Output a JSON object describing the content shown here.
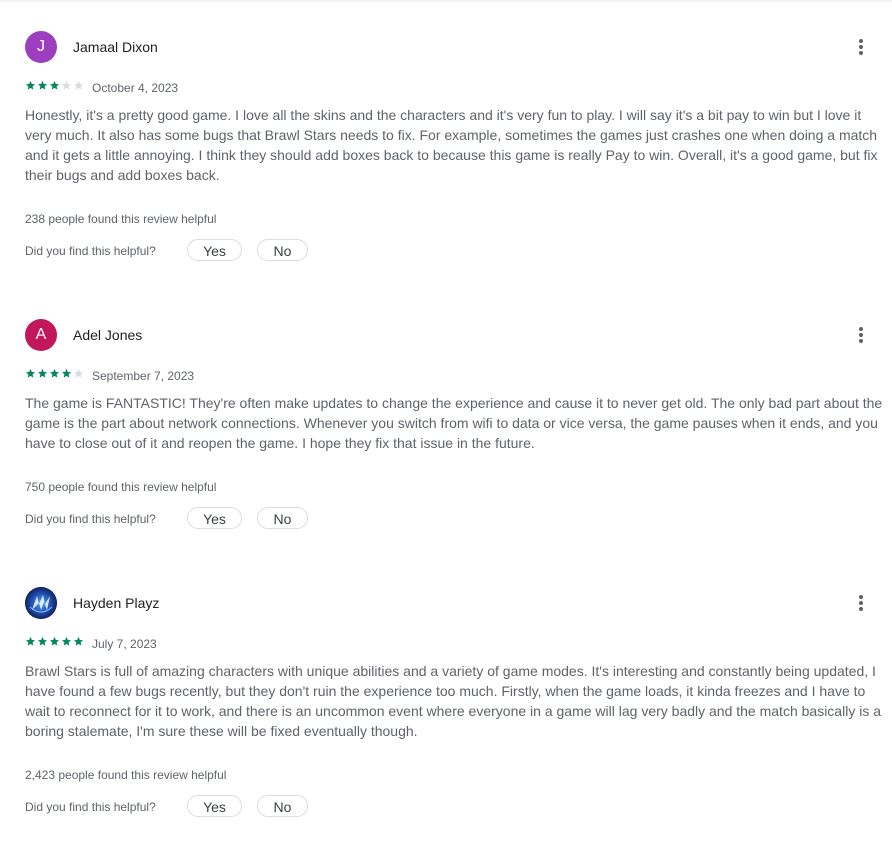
{
  "colors": {
    "star_filled": "#01875f",
    "star_empty": "#dadce0",
    "text_secondary": "#5f6368"
  },
  "reviews": [
    {
      "author": "Jamaal Dixon",
      "avatar_letter": "J",
      "avatar_color": "#9c3fbf",
      "rating": 3,
      "date": "October 4, 2023",
      "text": "Honestly, it's a pretty good game. I love all the skins and the characters and it's very fun to play. I will say it's a bit pay to win but I love it very much. It also has some bugs that Brawl Stars needs to fix. For example, sometimes the games just crashes one when doing a match and it gets a little annoying. I think they should add boxes back to because this game is really Pay to win. Overall, it's a good game, but fix their bugs and add boxes back.",
      "helpful_count": "238 people found this review helpful",
      "helpful_question": "Did you find this helpful?",
      "yes_label": "Yes",
      "no_label": "No"
    },
    {
      "author": "Adel Jones",
      "avatar_letter": "A",
      "avatar_color": "#c2185b",
      "rating": 4,
      "date": "September 7, 2023",
      "text": "The game is FANTASTIC! They're often make updates to change the experience and cause it to never get old. The only bad part about the game is the part about network connections. Whenever you switch from wifi to data or vice versa, the game pauses when it ends, and you have to close out of it and reopen the game. I hope they fix that issue in the future.",
      "helpful_count": "750 people found this review helpful",
      "helpful_question": "Did you find this helpful?",
      "yes_label": "Yes",
      "no_label": "No"
    },
    {
      "author": "Hayden Playz",
      "avatar_letter": "",
      "avatar_color": "#0b1d52",
      "rating": 5,
      "date": "July 7, 2023",
      "text": "Brawl Stars is full of amazing characters with unique abilities and a variety of game modes. It's interesting and constantly being updated, I have found a few bugs recently, but they don't ruin the experience too much. Firstly, when the game loads, it kinda freezes and I have to wait to reconnect for it to work, and there is an uncommon event where everyone in a game will lag very badly and the match basically is a boring stalemate, I'm sure these will be fixed eventually though.",
      "helpful_count": "2,423 people found this review helpful",
      "helpful_question": "Did you find this helpful?",
      "yes_label": "Yes",
      "no_label": "No"
    }
  ]
}
